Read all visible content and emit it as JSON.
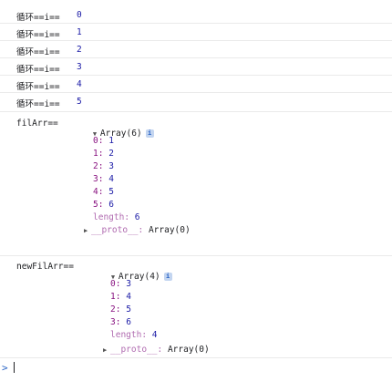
{
  "loop_logs": [
    {
      "label": "循环==i==",
      "value": "0"
    },
    {
      "label": "循环==i==",
      "value": "1"
    },
    {
      "label": "循环==i==",
      "value": "2"
    },
    {
      "label": "循环==i==",
      "value": "3"
    },
    {
      "label": "循环==i==",
      "value": "4"
    },
    {
      "label": "循环==i==",
      "value": "5"
    }
  ],
  "filArr": {
    "label": "filArr==",
    "summary": "Array(6)",
    "info_glyph": "i",
    "entries": [
      {
        "key": "0:",
        "value": "1"
      },
      {
        "key": "1:",
        "value": "2"
      },
      {
        "key": "2:",
        "value": "3"
      },
      {
        "key": "3:",
        "value": "4"
      },
      {
        "key": "4:",
        "value": "5"
      },
      {
        "key": "5:",
        "value": "6"
      }
    ],
    "length_key": "length:",
    "length_value": "6",
    "proto_key": "__proto__:",
    "proto_value": "Array(0)"
  },
  "newFilArr": {
    "label": "newFilArr==",
    "summary": "Array(4)",
    "info_glyph": "i",
    "entries": [
      {
        "key": "0:",
        "value": "3"
      },
      {
        "key": "1:",
        "value": "4"
      },
      {
        "key": "2:",
        "value": "5"
      },
      {
        "key": "3:",
        "value": "6"
      }
    ],
    "length_key": "length:",
    "length_value": "4",
    "proto_key": "__proto__:",
    "proto_value": "Array(0)"
  },
  "console_prompt": ">",
  "icons": {
    "expand": "triangle-down-icon",
    "collapse": "triangle-right-icon",
    "info": "info-icon"
  },
  "colors": {
    "key": "#881280",
    "number": "#1a1aa6",
    "prompt": "#2b64c5",
    "divider": "#eaeaea"
  }
}
